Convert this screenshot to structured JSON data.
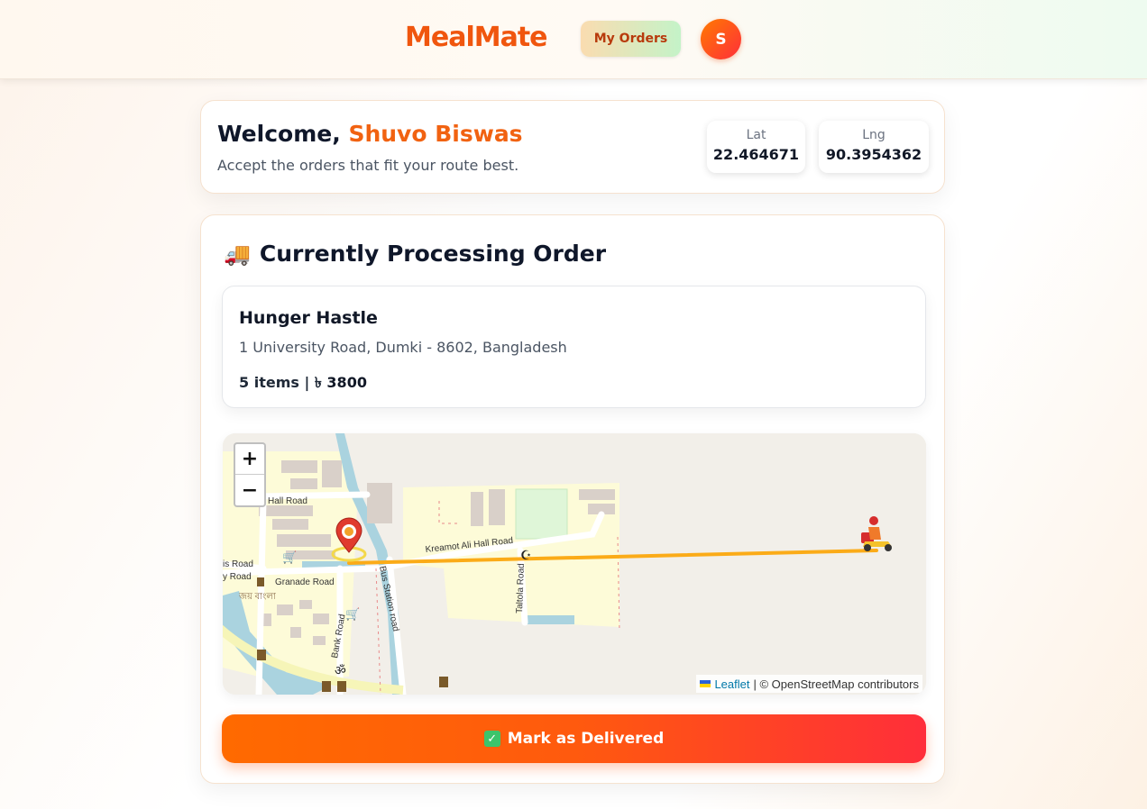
{
  "header": {
    "logo": "MealMate",
    "orders_label": "My Orders",
    "avatar_initial": "S"
  },
  "welcome": {
    "greeting": "Welcome,",
    "name": "Shuvo Biswas",
    "subtitle": "Accept the orders that fit your route best.",
    "lat_label": "Lat",
    "lat_value": "22.464671",
    "lng_label": "Lng",
    "lng_value": "90.3954362"
  },
  "processing": {
    "title": "Currently Processing Order",
    "icon": "truck-icon",
    "restaurant_name": "Hunger Hastle",
    "address": "1 University Road, Dumki - 8602, Bangladesh",
    "items_text": "5 items | ৳",
    "amount": "3800",
    "button_label": "Mark as Delivered"
  },
  "map": {
    "zoom_in": "+",
    "zoom_out": "−",
    "attribution_link": "Leaflet",
    "attribution_text": "| © OpenStreetMap contributors",
    "road_labels": {
      "hall_road": "Hall Road",
      "kreamot": "Kreamot Ali Hall Road",
      "granade": "Granade Road",
      "is_road": "is Road",
      "y_road": "y Road",
      "bus_station": "Bus Station road",
      "taltola": "Taltola Road",
      "bank_road": "Bank Road",
      "bangla": "জয় বাংলা"
    },
    "route_color": "#fbab18"
  }
}
